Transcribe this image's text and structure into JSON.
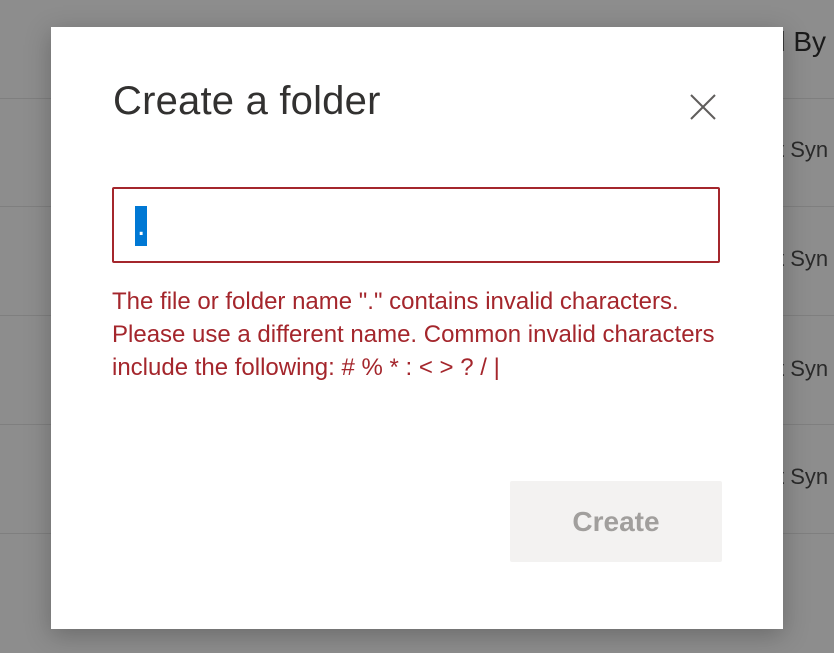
{
  "background": {
    "column_header": "d By",
    "rows": [
      "t Syn",
      "t Syn",
      "t Syn",
      "t Syn"
    ]
  },
  "dialog": {
    "title": "Create a folder",
    "close_icon": "close-icon",
    "input": {
      "value": ".",
      "placeholder": ""
    },
    "error_message": "The file or folder name \".\" contains invalid characters. Please use a different name. Common invalid characters include the following: # % * : < > ? / |",
    "create_label": "Create"
  },
  "colors": {
    "error": "#a4262c",
    "selection": "#0078d4",
    "disabled_button_bg": "#f3f2f1",
    "disabled_button_text": "#a19f9d",
    "title": "#323130"
  }
}
